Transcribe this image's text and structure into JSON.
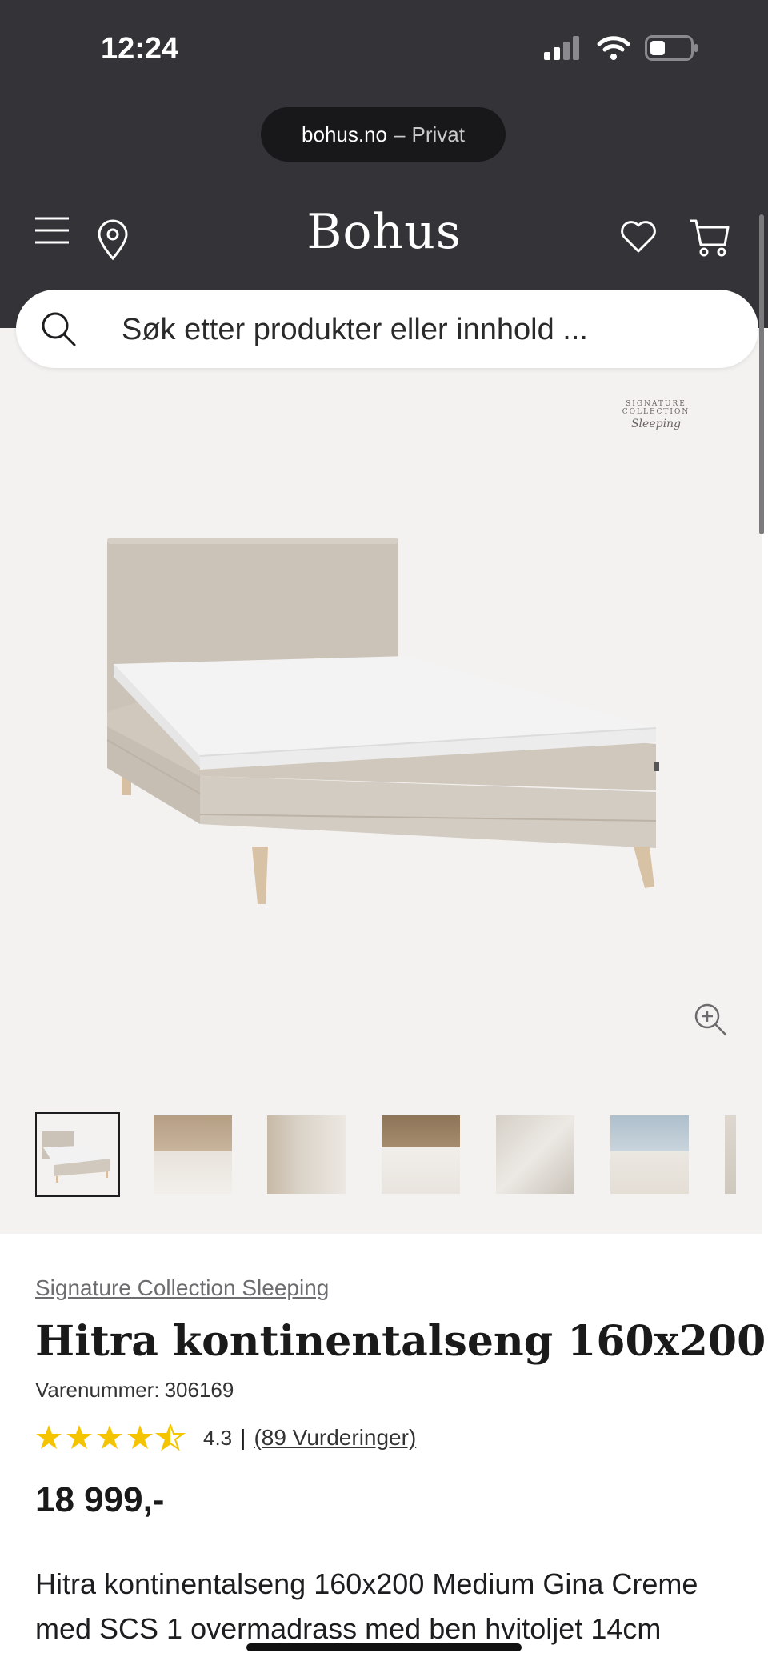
{
  "status_bar": {
    "time": "12:24"
  },
  "browser": {
    "domain": "bohus.no",
    "separator": "–",
    "mode": "Privat"
  },
  "header": {
    "logo": "Bohus",
    "icons": [
      "menu-icon",
      "location-pin-icon",
      "heart-icon",
      "cart-icon"
    ]
  },
  "search": {
    "placeholder": "Søk etter produkter eller innhold ..."
  },
  "gallery": {
    "badge_line1": "SIGNATURE COLLECTION",
    "badge_line2": "Sleeping",
    "thumbnail_count_visible": 7,
    "active_thumbnail": 1
  },
  "product": {
    "brand": "Signature Collection Sleeping",
    "title": "Hitra kontinentalseng 160x200",
    "sku_label": "Varenummer:",
    "sku": "306169",
    "rating": 4.3,
    "rating_text": "4.3",
    "reviews_text": "(89 Vurderinger)",
    "price": "18 999,-",
    "description": "Hitra kontinentalseng 160x200 Medium Gina Creme med SCS 1 overmadrass med ben hvitoljet 14cm"
  },
  "colors": {
    "header_bg": "#343438",
    "gallery_bg": "#f4f2f0",
    "star": "#f5c400"
  }
}
